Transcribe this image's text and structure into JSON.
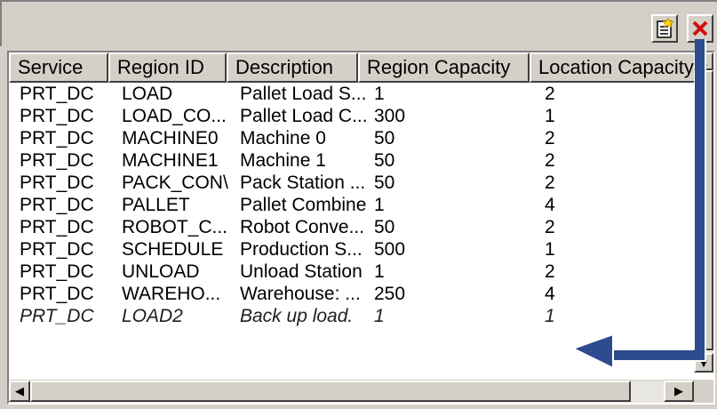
{
  "toolbar": {
    "new_icon": "new-document-icon",
    "delete_icon": "delete-x-icon"
  },
  "columns": [
    "Service",
    "Region ID",
    "Description",
    "Region Capacity",
    "Location Capacity"
  ],
  "rows": [
    [
      "PRT_DC",
      "LOAD",
      "Pallet Load S...",
      "1",
      "2"
    ],
    [
      "PRT_DC",
      "LOAD_CO...",
      "Pallet Load C...",
      "300",
      "1"
    ],
    [
      "PRT_DC",
      "MACHINE0",
      "Machine 0",
      "50",
      "2"
    ],
    [
      "PRT_DC",
      "MACHINE1",
      "Machine 1",
      "50",
      "2"
    ],
    [
      "PRT_DC",
      "PACK_CON\\",
      "Pack Station ...",
      "50",
      "2"
    ],
    [
      "PRT_DC",
      "PALLET",
      "Pallet Combine",
      "1",
      "4"
    ],
    [
      "PRT_DC",
      "ROBOT_C...",
      "Robot Conve...",
      "50",
      "2"
    ],
    [
      "PRT_DC",
      "SCHEDULE",
      "Production S...",
      "500",
      "1"
    ],
    [
      "PRT_DC",
      "UNLOAD",
      "Unload Station",
      "1",
      "2"
    ],
    [
      "PRT_DC",
      "WAREHO...",
      "Warehouse: ...",
      "250",
      "4"
    ]
  ],
  "pending_row": [
    "PRT_DC",
    "LOAD2",
    "Back up load.",
    "1",
    "1"
  ],
  "scrollbars": {
    "up": "▲",
    "down": "▼",
    "left": "◀",
    "right": "▶"
  },
  "annotation": {
    "arrow_color": "#2d4b8f"
  }
}
